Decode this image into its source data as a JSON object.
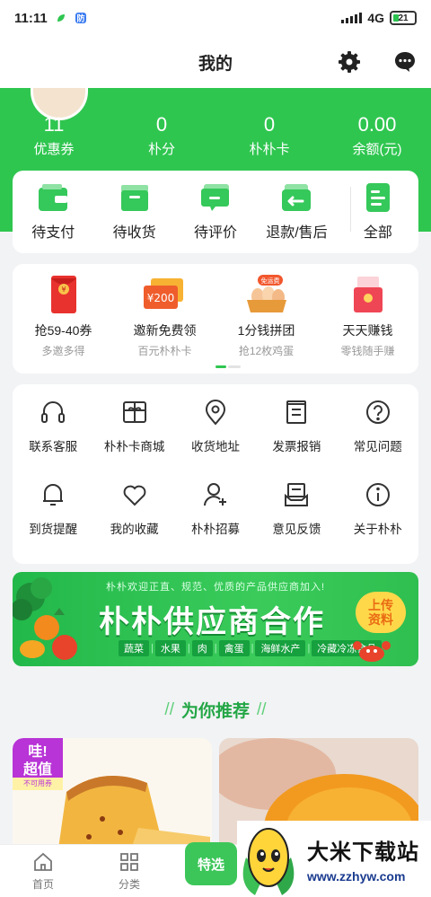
{
  "status_bar": {
    "time": "11:11",
    "network": "4G",
    "battery": "21"
  },
  "header": {
    "title": "我的"
  },
  "stats": [
    {
      "value": "11",
      "label": "优惠券"
    },
    {
      "value": "0",
      "label": "朴分"
    },
    {
      "value": "0",
      "label": "朴朴卡"
    },
    {
      "value": "0.00",
      "label": "余额(元)"
    }
  ],
  "orders": [
    {
      "label": "待支付",
      "icon": "wallet-icon"
    },
    {
      "label": "待收货",
      "icon": "box-icon"
    },
    {
      "label": "待评价",
      "icon": "comment-icon"
    },
    {
      "label": "退款/售后",
      "icon": "refund-icon"
    },
    {
      "label": "全部",
      "icon": "list-icon"
    }
  ],
  "promos": [
    {
      "title": "抢59-40券",
      "sub": "多邀多得",
      "icon": "red-envelope-icon"
    },
    {
      "title": "邀新免费领",
      "sub": "百元朴朴卡",
      "icon": "gift-card-icon",
      "card_text": "¥200"
    },
    {
      "title": "1分钱拼团",
      "sub": "抢12枚鸡蛋",
      "icon": "eggs-icon",
      "badge": "免运费"
    },
    {
      "title": "天天赚钱",
      "sub": "零钱随手赚",
      "icon": "coin-envelope-icon"
    }
  ],
  "services": [
    {
      "label": "联系客服",
      "icon": "headset-icon"
    },
    {
      "label": "朴朴卡商城",
      "icon": "gift-card-icon"
    },
    {
      "label": "收货地址",
      "icon": "location-icon"
    },
    {
      "label": "发票报销",
      "icon": "invoice-icon"
    },
    {
      "label": "常见问题",
      "icon": "question-icon"
    },
    {
      "label": "到货提醒",
      "icon": "bell-icon"
    },
    {
      "label": "我的收藏",
      "icon": "heart-icon"
    },
    {
      "label": "朴朴招募",
      "icon": "add-user-icon"
    },
    {
      "label": "意见反馈",
      "icon": "feedback-icon"
    },
    {
      "label": "关于朴朴",
      "icon": "info-icon"
    }
  ],
  "banner": {
    "top_text": "朴朴欢迎正直、规范、优质的产品供应商加入!",
    "main_text": "朴朴供应商合作",
    "categories": [
      "蔬菜",
      "水果",
      "肉",
      "禽蛋",
      "海鲜水产",
      "冷藏冷冻食品"
    ],
    "button_line1": "上传",
    "button_line2": "资料"
  },
  "recommend": {
    "title": "为你推荐"
  },
  "product_badge": {
    "line1": "哇!",
    "line2": "超值",
    "tag": "不可用券"
  },
  "bottom_nav": [
    {
      "label": "首页",
      "icon": "home-icon"
    },
    {
      "label": "分类",
      "icon": "grid-icon"
    },
    {
      "label": "特选",
      "icon": "bag-icon"
    }
  ],
  "watermark": {
    "title": "大米下载站",
    "url": "www.zzhyw.com"
  },
  "colors": {
    "brand_green": "#2fc650",
    "text": "#222222",
    "muted": "#999999"
  }
}
